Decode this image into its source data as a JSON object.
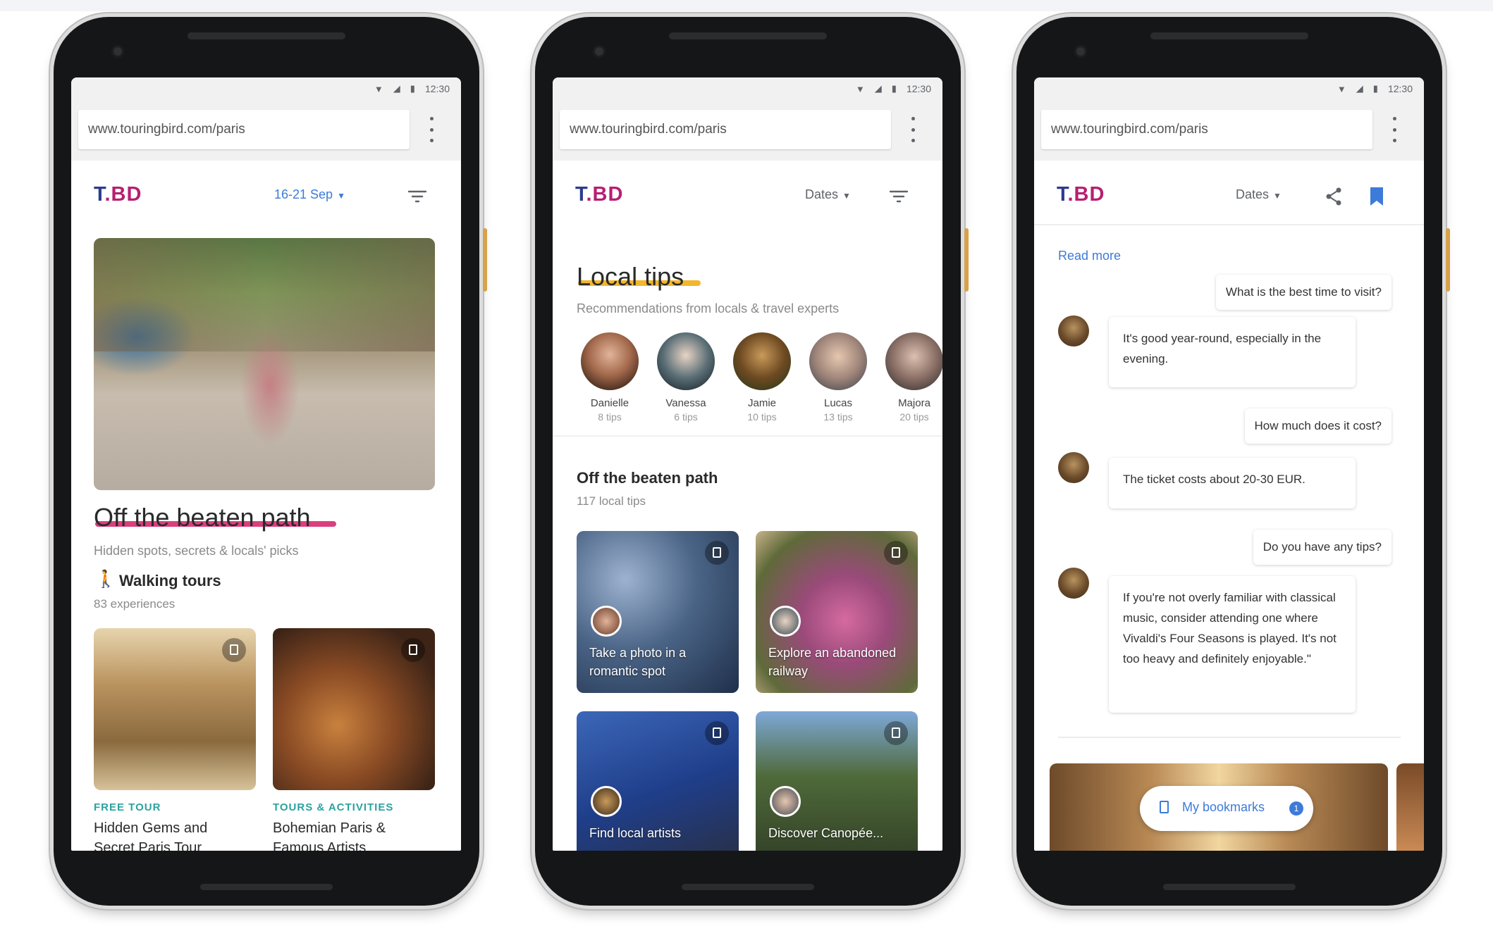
{
  "browser": {
    "url": "www.touringbird.com/paris",
    "time": "12:30"
  },
  "app": {
    "logo_prefix": "T",
    "logo_suffix": ".BD",
    "brand_color": "#b71f71"
  },
  "phone1": {
    "dates_label": "16-21 Sep",
    "section_title": "Off the beaten path",
    "section_subtitle": "Hidden spots, secrets & locals' picks",
    "category_title": "Walking tours",
    "category_count": "83 experiences",
    "cards": [
      {
        "tag": "FREE TOUR",
        "title": "Hidden Gems and Secret Paris Tour"
      },
      {
        "tag": "TOURS & ACTIVITIES",
        "title": "Bohemian Paris & Famous Artists"
      }
    ]
  },
  "phone2": {
    "dates_label": "Dates",
    "section_title": "Local tips",
    "section_subtitle": "Recommendations from locals & travel experts",
    "experts": [
      {
        "name": "Danielle",
        "tips": "8 tips"
      },
      {
        "name": "Vanessa",
        "tips": "6 tips"
      },
      {
        "name": "Jamie",
        "tips": "10 tips"
      },
      {
        "name": "Lucas",
        "tips": "13 tips"
      },
      {
        "name": "Majora",
        "tips": "20 tips"
      }
    ],
    "list_title": "Off the beaten path",
    "list_count": "117 local tips",
    "tip_cards": [
      {
        "text": "Take a photo in a romantic spot"
      },
      {
        "text": "Explore an abandoned railway"
      },
      {
        "text": "Find local artists"
      },
      {
        "text": "Discover Canopée..."
      }
    ]
  },
  "phone3": {
    "dates_label": "Dates",
    "read_more": "Read more",
    "chat": [
      {
        "question": "What is the best time to visit?",
        "answer": "It's good year-round, especially in the evening."
      },
      {
        "question": "How much does it cost?",
        "answer": "The ticket costs about 20-30 EUR."
      },
      {
        "question": "Do you have any tips?",
        "answer": "If you're not overly familiar with classical music, consider attending one where Vivaldi's Four Seasons is played. It's not too heavy and definitely enjoyable.\""
      }
    ],
    "bookmarks_label": "My bookmarks",
    "bookmarks_count": "1"
  }
}
